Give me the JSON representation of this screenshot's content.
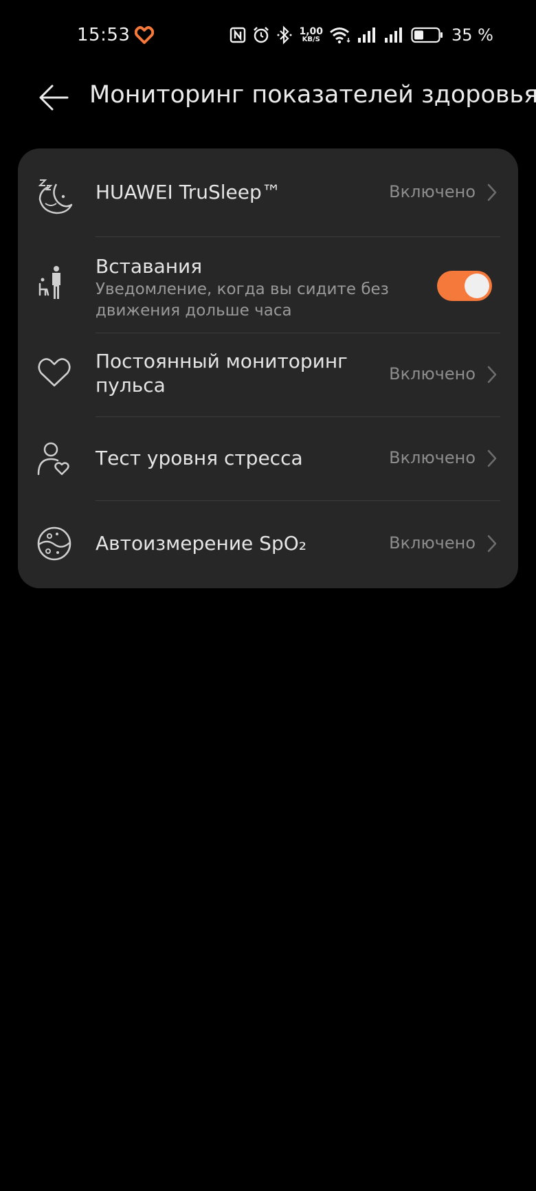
{
  "status_bar": {
    "time": "15:53",
    "net_speed_value": "1,00",
    "net_speed_unit": "KB/S",
    "battery_percent": "35 %",
    "icons": [
      "health-app-icon",
      "nfc-icon",
      "alarm-icon",
      "bluetooth-icon",
      "wifi-icon",
      "signal-icon",
      "signal-icon",
      "battery-icon"
    ],
    "accent_color": "#f5793b"
  },
  "header": {
    "title": "Мониторинг показателей здоровья"
  },
  "settings": [
    {
      "title": "HUAWEI TruSleep™",
      "value": "Включено",
      "icon": "sleep-moon-icon"
    },
    {
      "title": "Вставания",
      "subtitle_line1": "Уведомление, когда вы сидите без",
      "subtitle_line2": "движения дольше часа",
      "toggle_on": true,
      "icon": "stand-up-icon"
    },
    {
      "title_line1": "Постоянный мониторинг",
      "title_line2": "пульса",
      "value": "Включено",
      "icon": "heart-icon"
    },
    {
      "title": "Тест уровня стресса",
      "value": "Включено",
      "icon": "person-heart-icon"
    },
    {
      "title": "Автоизмерение SpO₂",
      "value": "Включено",
      "icon": "spo2-icon"
    }
  ],
  "colors": {
    "background": "#000000",
    "card": "#272727",
    "toggle_on": "#f5793b"
  }
}
